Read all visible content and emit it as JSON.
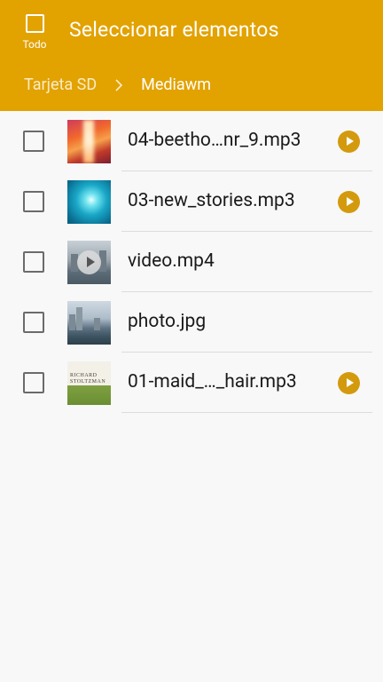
{
  "header": {
    "select_all_label": "Todo",
    "title": "Seleccionar elementos",
    "breadcrumb": [
      "Tarjeta SD",
      "Mediawm"
    ]
  },
  "files": [
    {
      "name": "04-beetho…nr_9.mp3",
      "thumbnail": "beethoven-album-art",
      "playable": true
    },
    {
      "name": "03-new_stories.mp3",
      "thumbnail": "new-stories-album-art",
      "playable": true
    },
    {
      "name": "video.mp4",
      "thumbnail": "video-thumbnail",
      "playable": false
    },
    {
      "name": "photo.jpg",
      "thumbnail": "photo-thumbnail",
      "playable": false
    },
    {
      "name": "01-maid_…_hair.mp3",
      "thumbnail": "richard-stoltzman-album-art",
      "album_text": "RICHARD STOLTZMAN",
      "playable": true
    }
  ],
  "colors": {
    "header_bg": "#e2a200",
    "play_button": "#d39a0d",
    "background": "#f8f8f8"
  }
}
